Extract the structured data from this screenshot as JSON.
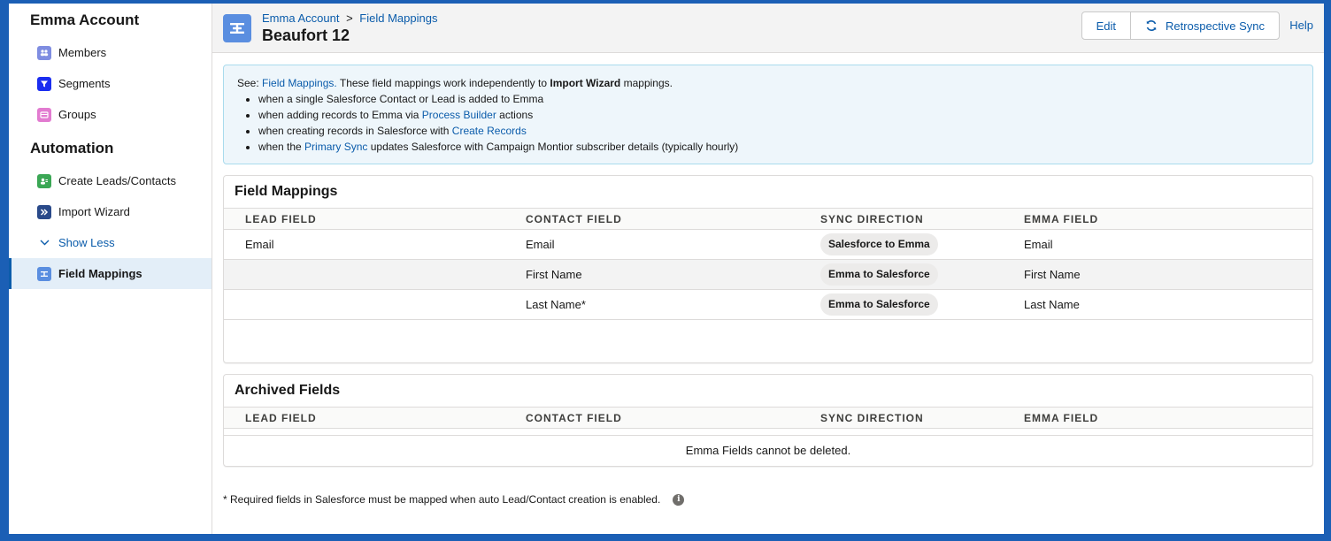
{
  "sidebar": {
    "account_heading": "Emma Account",
    "account_items": [
      {
        "label": "Members",
        "icon": "members-icon",
        "color": "#7f8de1"
      },
      {
        "label": "Segments",
        "icon": "filter-icon",
        "color": "#1b2ef0"
      },
      {
        "label": "Groups",
        "icon": "groups-icon",
        "color": "#e27bd0"
      }
    ],
    "automation_heading": "Automation",
    "automation_items": [
      {
        "label": "Create Leads/Contacts",
        "icon": "contacts-icon",
        "color": "#3ba755"
      },
      {
        "label": "Import Wizard",
        "icon": "import-icon",
        "color": "#2a4a8a"
      }
    ],
    "show_less": "Show Less",
    "active_item": "Field Mappings"
  },
  "header": {
    "breadcrumb_1": "Emma Account",
    "breadcrumb_sep": ">",
    "breadcrumb_2": "Field Mappings",
    "title": "Beaufort 12",
    "edit_label": "Edit",
    "sync_label": "Retrospective Sync",
    "help_label": "Help"
  },
  "info": {
    "see": "See:",
    "see_link": "Field Mappings.",
    "intro": "These field mappings work independently to",
    "import_wizard": "Import Wizard",
    "intro_end": "mappings.",
    "bullet_1": "when a single Salesforce Contact or Lead is added to Emma",
    "bullet_2_pre": "when adding records to Emma via",
    "bullet_2_link": "Process Builder",
    "bullet_2_post": "actions",
    "bullet_3_pre": "when creating records in Salesforce with",
    "bullet_3_link": "Create Records",
    "bullet_4_pre": "when the",
    "bullet_4_link": "Primary Sync",
    "bullet_4_post": "updates Salesforce with Campaign Montior subscriber details (typically hourly)"
  },
  "columns": {
    "lead": "LEAD FIELD",
    "contact": "CONTACT FIELD",
    "direction": "SYNC DIRECTION",
    "emma": "EMMA FIELD"
  },
  "field_mappings": {
    "title": "Field Mappings",
    "rows": [
      {
        "lead": "Email",
        "contact": "Email",
        "direction": "Salesforce to Emma",
        "emma": "Email"
      },
      {
        "lead": "",
        "contact": "First Name",
        "direction": "Emma to Salesforce",
        "emma": "First Name"
      },
      {
        "lead": "",
        "contact": "Last Name*",
        "direction": "Emma to Salesforce",
        "emma": "Last Name"
      }
    ]
  },
  "archived": {
    "title": "Archived Fields",
    "message": "Emma Fields cannot be deleted."
  },
  "footnote": "* Required fields in Salesforce must be mapped when auto Lead/Contact creation is enabled."
}
